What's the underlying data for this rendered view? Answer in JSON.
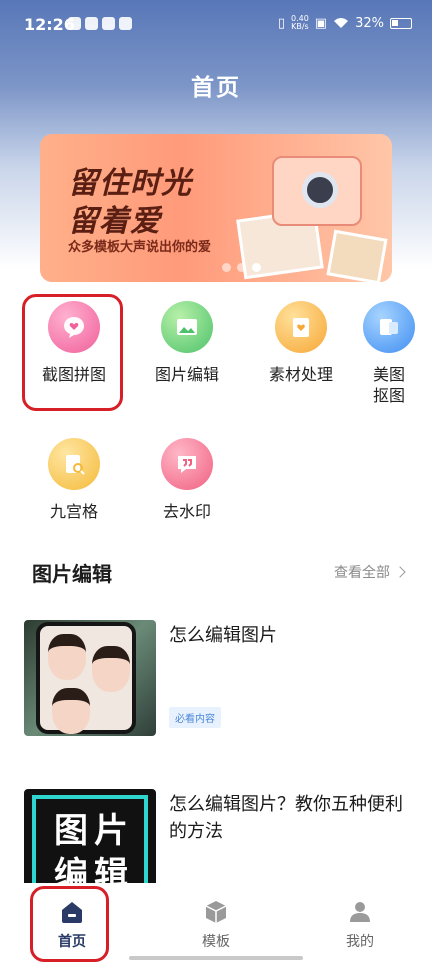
{
  "status_bar": {
    "time": "12:26",
    "speed_value": "0.40",
    "speed_unit": "KB/s",
    "battery": "32%"
  },
  "header": {
    "title": "首页"
  },
  "banner": {
    "line1": "留住时光",
    "line2": "留着爱",
    "subtitle": "众多模板大声说出你的爱"
  },
  "features": [
    {
      "label": "截图拼图",
      "icon": "heart-chat-icon",
      "color": "#f0609a"
    },
    {
      "label": "图片编辑",
      "icon": "image-icon",
      "color": "#4dc26b"
    },
    {
      "label": "素材处理",
      "icon": "clipboard-heart-icon",
      "color": "#f7a735"
    },
    {
      "label": "美图\n抠图",
      "icon": "cutout-icon",
      "color": "#3f8ef2"
    },
    {
      "label": "九宫格",
      "icon": "grid-search-icon",
      "color": "#f4ba3a"
    },
    {
      "label": "去水印",
      "icon": "quote-bubble-icon",
      "color": "#f06080"
    }
  ],
  "section": {
    "title": "图片编辑",
    "more": "查看全部"
  },
  "articles": [
    {
      "title": "怎么编辑图片",
      "tag": "必看内容"
    },
    {
      "title": "怎么编辑图片？教你五种便利的方法",
      "thumb_text_1": "图片",
      "thumb_text_2": "编辑"
    }
  ],
  "tabbar": {
    "home": "首页",
    "templates": "模板",
    "mine": "我的"
  },
  "colors": {
    "highlight": "#d61f26",
    "active_tab": "#2a3a66"
  }
}
